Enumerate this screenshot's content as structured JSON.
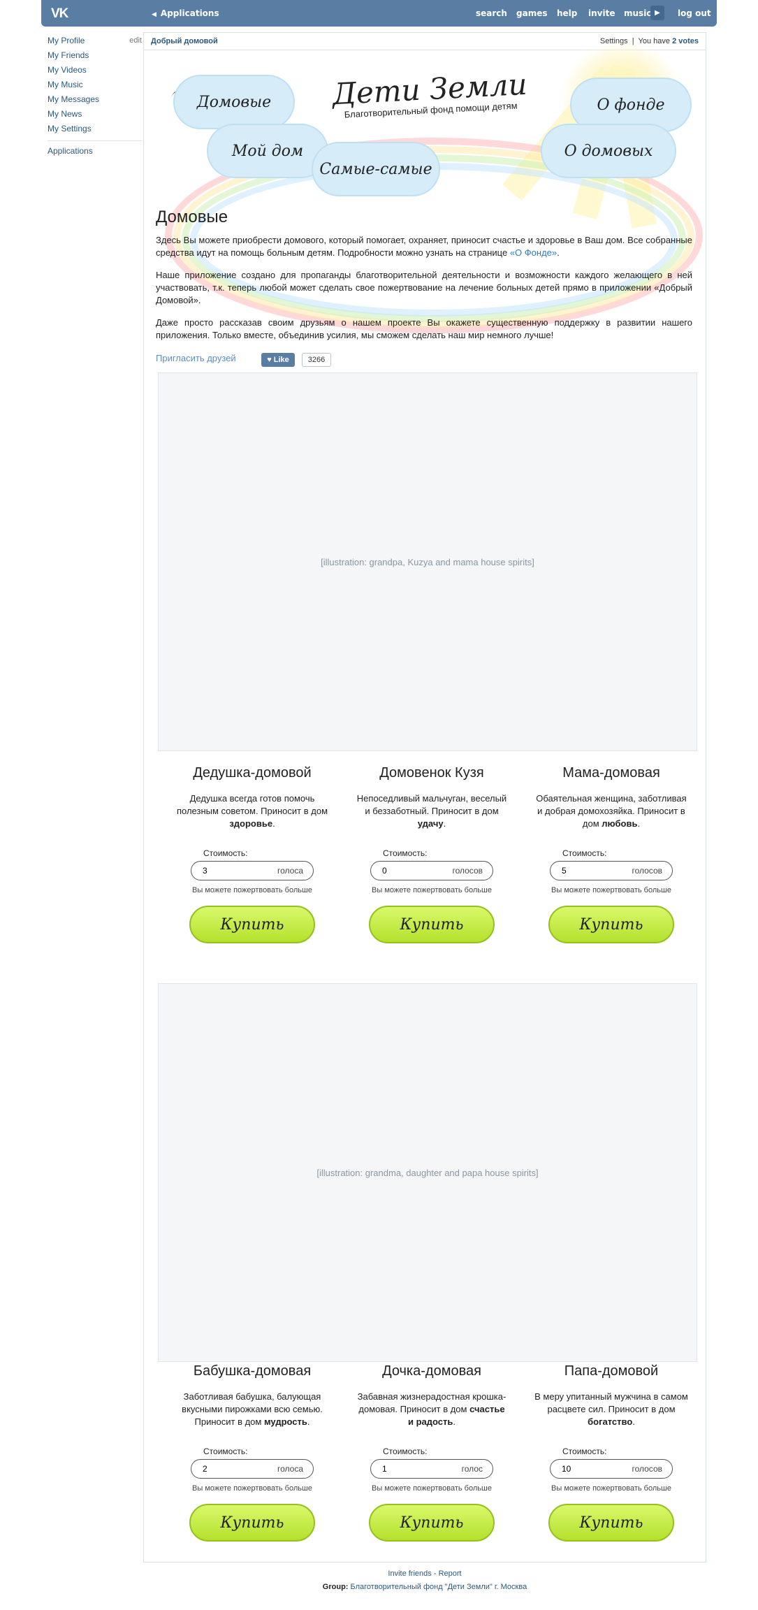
{
  "topbar": {
    "logo": "VK",
    "apps_label": "Applications",
    "nav": [
      "search",
      "games",
      "help",
      "invite",
      "music",
      "log out"
    ]
  },
  "sidebar": {
    "items": [
      "My Profile",
      "My Friends",
      "My Videos",
      "My Music",
      "My Messages",
      "My News",
      "My Settings"
    ],
    "edit": "edit",
    "applications": "Applications"
  },
  "app_header": {
    "title": "Добрый домовой",
    "settings": "Settings",
    "votes_prefix": "You have",
    "votes": "2 votes"
  },
  "banner": {
    "title": "Дети Земли",
    "subtitle": "Благотворительный фонд помощи детям",
    "clouds": [
      "Домовые",
      "Мой дом",
      "Самые-самые",
      "О фонде",
      "О домовых"
    ]
  },
  "intro": {
    "heading": "Домовые",
    "p1": "Здесь Вы можете приобрести домового, который помогает, охраняет, приносит счастье и здоровье в Ваш дом. Все собранные средства идут на помощь больным детям. Подробности можно узнать на странице ",
    "p1_link": "«О Фонде»",
    "p1_end": ".",
    "p2": "Наше приложение создано для пропаганды благотворительной деятельности и возможности каждого желающего в ней участвовать, т.к. теперь любой может сделать свое пожертвование на лечение больных детей прямо в приложении «Добрый Домовой».",
    "p3": "Даже просто рассказав своим друзьям о нашем проекте Вы окажете существенную поддержку в развитии нашего приложения. Только вместе, объединив усилия, мы сможем сделать наш мир немного лучше!",
    "invite": "Пригласить друзей",
    "like": "Like",
    "like_count": "3266"
  },
  "art": {
    "group1": "[illustration: grandpa, Kuzya and mama house spirits]",
    "group2": "[illustration: grandma, daughter and papa house spirits]"
  },
  "cards": [
    {
      "name": "Дедушка-домовой",
      "desc_a": "Дедушка всегда готов помочь полезным советом. Приносит в дом ",
      "desc_b": "здоровье",
      "desc_c": ".",
      "price_label": "Стоимость:",
      "value": "3",
      "unit": "голоса",
      "hint": "Вы можете пожертвовать больше",
      "buy": "Купить"
    },
    {
      "name": "Домовенок Кузя",
      "desc_a": "Непоседливый мальчуган, веселый и беззаботный. Приносит в дом ",
      "desc_b": "удачу",
      "desc_c": ".",
      "price_label": "Стоимость:",
      "value": "0",
      "unit": "голосов",
      "hint": "Вы можете пожертвовать больше",
      "buy": "Купить"
    },
    {
      "name": "Мама-домовая",
      "desc_a": "Обаятельная женщина, заботливая и добрая домохозяйка. Приносит в дом ",
      "desc_b": "любовь",
      "desc_c": ".",
      "price_label": "Стоимость:",
      "value": "5",
      "unit": "голосов",
      "hint": "Вы можете пожертвовать больше",
      "buy": "Купить"
    },
    {
      "name": "Бабушка-домовая",
      "desc_a": "Заботливая бабушка, балующая вкусными пирожками всю семью. Приносит в дом ",
      "desc_b": "мудрость",
      "desc_c": ".",
      "price_label": "Стоимость:",
      "value": "2",
      "unit": "голоса",
      "hint": "Вы можете пожертвовать больше",
      "buy": "Купить"
    },
    {
      "name": "Дочка-домовая",
      "desc_a": "Забавная жизнерадостная крошка-домовая. Приносит в дом ",
      "desc_b": "счастье и радость",
      "desc_c": ".",
      "price_label": "Стоимость:",
      "value": "1",
      "unit": "голос",
      "hint": "Вы можете пожертвовать больше",
      "buy": "Купить"
    },
    {
      "name": "Папа-домовой",
      "desc_a": "В меру упитанный мужчина в самом расцвете сил. Приносит в дом ",
      "desc_b": "богатство",
      "desc_c": ".",
      "price_label": "Стоимость:",
      "value": "10",
      "unit": "голосов",
      "hint": "Вы можете пожертвовать больше",
      "buy": "Купить"
    }
  ],
  "footer": {
    "invite": "Invite friends",
    "sep": " - ",
    "report": "Report",
    "group_label": "Group:",
    "group_name": "Благотворительный фонд \"Дети Земли\" г. Москва"
  }
}
